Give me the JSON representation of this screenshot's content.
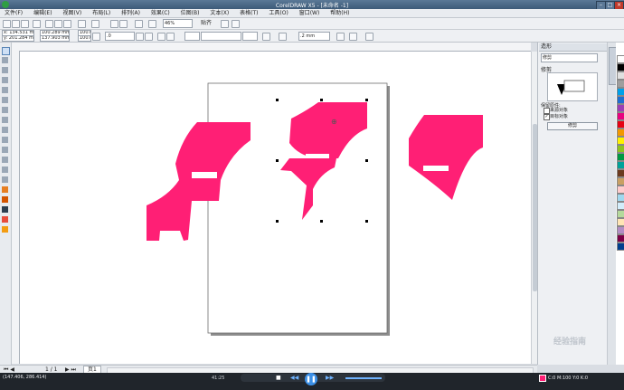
{
  "window": {
    "title": "CorelDRAW X5 - [未命名 -1]",
    "controls": [
      "–",
      "□",
      "×"
    ]
  },
  "menu": [
    "文件(F)",
    "编辑(E)",
    "视图(V)",
    "布局(L)",
    "排列(A)",
    "效果(C)",
    "位图(B)",
    "文本(X)",
    "表格(T)",
    "工具(O)",
    "窗口(W)",
    "帮助(H)"
  ],
  "toolbar": {
    "zoom": "46%",
    "snap_label": "贴齐"
  },
  "properties": {
    "x": "x: 134.531 mm",
    "y": "y: 201.284 mm",
    "width": "100.289 mm",
    "height": "137.903 mm",
    "scale_x": "100.0",
    "scale_y": "100.0",
    "rotation": ".0",
    "outline_width": ".2 mm"
  },
  "docker": {
    "title": "造形",
    "mode": "修剪",
    "section_label": "修剪",
    "keep_label": "保留原件:",
    "source_label": "来源对象",
    "target_label": "目标对象",
    "apply_button": "修剪"
  },
  "pagebar": {
    "page_count": "1 / 1",
    "page_tab": "页1"
  },
  "player": {
    "time": "41:25"
  },
  "status": {
    "coords": "(147.406, 286.414)",
    "fill_info": "C:0 M:100 Y:0 K:0",
    "watermark": "经验指南"
  },
  "colors": {
    "shape_fill": "#ff1f75",
    "accent": "#3b6ea8",
    "page_bg": "#ffffff"
  },
  "palette": [
    "#ffffff",
    "#000000",
    "#e0e0e0",
    "#9e9e9e",
    "#00a0e9",
    "#1d6fd1",
    "#9b3fb5",
    "#e9007f",
    "#e60012",
    "#f39800",
    "#fff100",
    "#8fc31f",
    "#009944",
    "#00a29a",
    "#6b3a1f",
    "#c9a063",
    "#ffcccc",
    "#a0d8ef",
    "#d3edfb",
    "#b5d99c",
    "#ffe5b4",
    "#b28cc4",
    "#7b0046",
    "#003f8e"
  ]
}
